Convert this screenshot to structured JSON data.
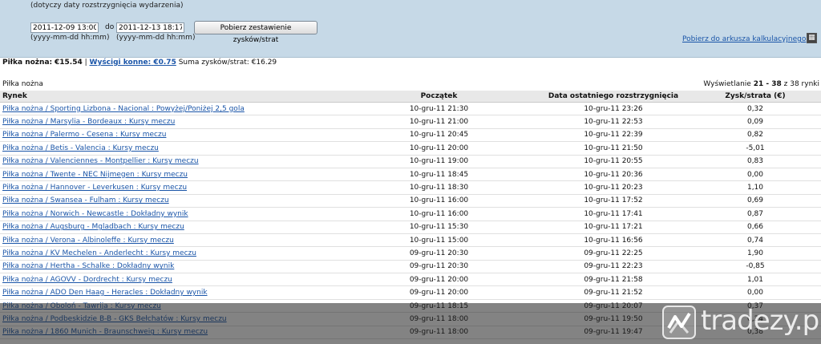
{
  "filters": {
    "note": "(dotyczy daty rozstrzygnięcia wydarzenia)",
    "from_value": "2011-12-09 13:00",
    "to_label": "do",
    "to_value": "2011-12-13 18:17",
    "format_hint": "(yyyy-mm-dd hh:mm)",
    "fetch_button": "Pobierz zestawienie zysków/strat",
    "sheet_link": "Pobierz do arkusza kalkulacyjnego",
    "sheet_icon": "spreadsheet-icon"
  },
  "summary": {
    "football_label": "Piłka nożna:",
    "football_value": "€15.54",
    "separator": "|",
    "horse_label": "Wyścigi konne:",
    "horse_value": "€0.75",
    "total_label": "Suma zysków/strat:",
    "total_value": "€16.29"
  },
  "section": {
    "title": "Piłka nożna",
    "paging_prefix": "Wyświetlanie",
    "paging_range": "21 - 38",
    "paging_suffix": "z 38 rynki"
  },
  "table": {
    "columns": [
      "Rynek",
      "Początek",
      "Data ostatniego rozstrzygnięcia",
      "Zysk/strata (€)"
    ],
    "rows": [
      {
        "market": "Piłka nożna / Sporting Lizbona - Nacional : Powyżej/Poniżej 2,5 gola",
        "start": "10-gru-11 21:30",
        "settled": "10-gru-11 23:26",
        "pl": "0,32"
      },
      {
        "market": "Piłka nożna / Marsylia - Bordeaux : Kursy meczu",
        "start": "10-gru-11 21:00",
        "settled": "10-gru-11 22:53",
        "pl": "0,09"
      },
      {
        "market": "Piłka nożna / Palermo - Cesena : Kursy meczu",
        "start": "10-gru-11 20:45",
        "settled": "10-gru-11 22:39",
        "pl": "0,82"
      },
      {
        "market": "Piłka nożna / Betis - Valencia : Kursy meczu",
        "start": "10-gru-11 20:00",
        "settled": "10-gru-11 21:50",
        "pl": "-5,01"
      },
      {
        "market": "Piłka nożna / Valenciennes - Montpellier : Kursy meczu",
        "start": "10-gru-11 19:00",
        "settled": "10-gru-11 20:55",
        "pl": "0,83"
      },
      {
        "market": "Piłka nożna / Twente - NEC Nijmegen : Kursy meczu",
        "start": "10-gru-11 18:45",
        "settled": "10-gru-11 20:36",
        "pl": "0,00"
      },
      {
        "market": "Piłka nożna / Hannover - Leverkusen : Kursy meczu",
        "start": "10-gru-11 18:30",
        "settled": "10-gru-11 20:23",
        "pl": "1,10"
      },
      {
        "market": "Piłka nożna / Swansea - Fulham : Kursy meczu",
        "start": "10-gru-11 16:00",
        "settled": "10-gru-11 17:52",
        "pl": "0,69"
      },
      {
        "market": "Piłka nożna / Norwich - Newcastle : Dokładny wynik",
        "start": "10-gru-11 16:00",
        "settled": "10-gru-11 17:41",
        "pl": "0,87"
      },
      {
        "market": "Piłka nożna / Augsburg - Mgladbach : Kursy meczu",
        "start": "10-gru-11 15:30",
        "settled": "10-gru-11 17:21",
        "pl": "0,66"
      },
      {
        "market": "Piłka nożna / Verona - Albinoleffe : Kursy meczu",
        "start": "10-gru-11 15:00",
        "settled": "10-gru-11 16:56",
        "pl": "0,74"
      },
      {
        "market": "Piłka nożna / KV Mechelen - Anderlecht : Kursy meczu",
        "start": "09-gru-11 20:30",
        "settled": "09-gru-11 22:25",
        "pl": "1,90"
      },
      {
        "market": "Piłka nożna / Hertha - Schalke : Dokładny wynik",
        "start": "09-gru-11 20:30",
        "settled": "09-gru-11 22:23",
        "pl": "-0,85"
      },
      {
        "market": "Piłka nożna / AGOVV - Dordrecht : Kursy meczu",
        "start": "09-gru-11 20:00",
        "settled": "09-gru-11 21:58",
        "pl": "1,01"
      },
      {
        "market": "Piłka nożna / ADO Den Haag - Heracles : Dokładny wynik",
        "start": "09-gru-11 20:00",
        "settled": "09-gru-11 21:52",
        "pl": "0,00"
      },
      {
        "market": "Piłka nożna / Oboloń - Tawrija : Kursy meczu",
        "start": "09-gru-11 18:15",
        "settled": "09-gru-11 20:07",
        "pl": "0,37"
      },
      {
        "market": "Piłka nożna / Podbeskidzie B-B - GKS Bełchatów : Kursy meczu",
        "start": "09-gru-11 18:00",
        "settled": "09-gru-11 19:50",
        "pl": "0,34"
      },
      {
        "market": "Piłka nożna / 1860 Munich - Braunschweig : Kursy meczu",
        "start": "09-gru-11 18:00",
        "settled": "09-gru-11 19:47",
        "pl": "0,38"
      }
    ]
  },
  "watermark": {
    "text": "tradezy.pl",
    "logo_icon": "tradezy-logo-icon"
  }
}
